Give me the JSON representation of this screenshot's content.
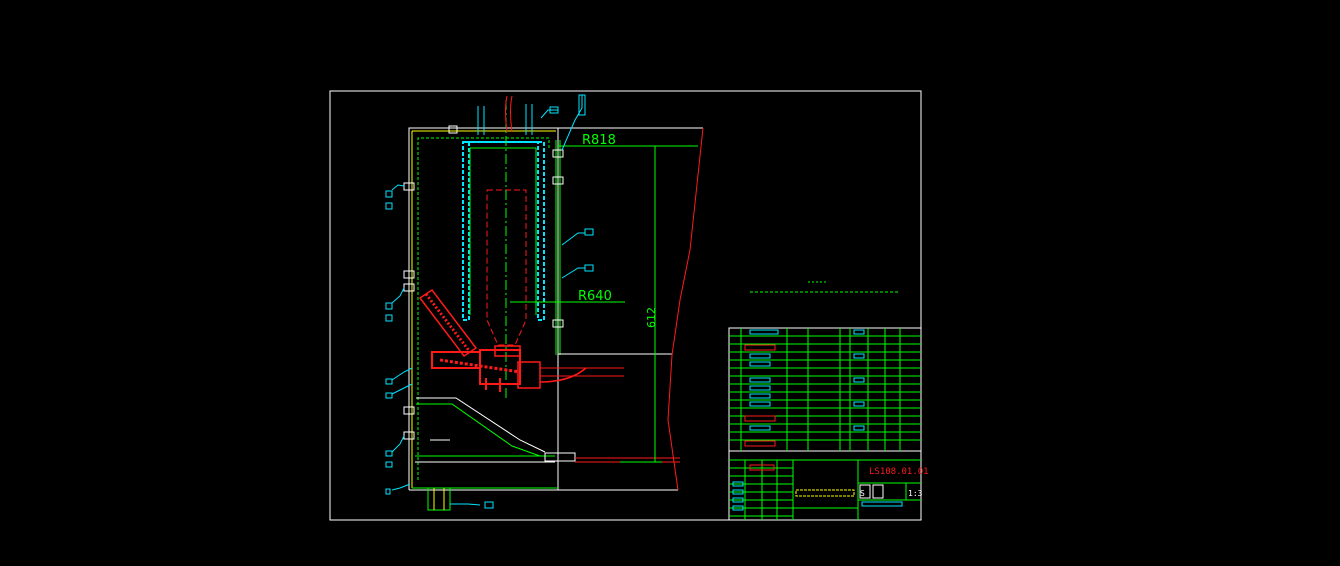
{
  "dimensions": {
    "radius_upper": "R818",
    "radius_lower": "R640",
    "height": "612"
  },
  "title_block": {
    "drawing_number": "LS108.01.01",
    "scale": "1:3",
    "sheet_mark": "S"
  },
  "colors": {
    "background": "#000000",
    "frame": "#ffffff",
    "green": "#00ff00",
    "cyan": "#00e5ff",
    "red": "#ff1a1a",
    "magenta": "#ff00ff",
    "yellow": "#ffff00"
  }
}
